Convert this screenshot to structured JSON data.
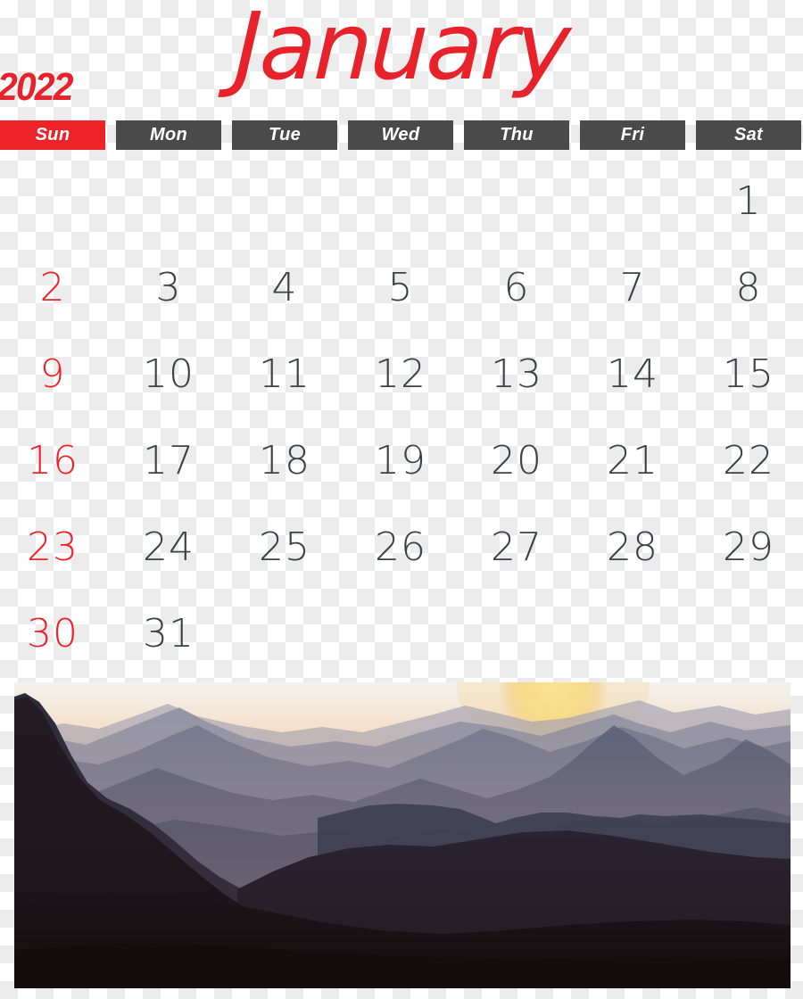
{
  "calendar": {
    "month": "January",
    "year": "2022",
    "accent_color": "#ee2229",
    "header_bar_color": "#4a4a4a",
    "date_text_color": "#3d4146",
    "weekdays": [
      {
        "short": "Sun",
        "highlight": true
      },
      {
        "short": "Mon",
        "highlight": false
      },
      {
        "short": "Tue",
        "highlight": false
      },
      {
        "short": "Wed",
        "highlight": false
      },
      {
        "short": "Thu",
        "highlight": false
      },
      {
        "short": "Fri",
        "highlight": false
      },
      {
        "short": "Sat",
        "highlight": false
      }
    ],
    "weeks": [
      [
        "",
        "",
        "",
        "",
        "",
        "",
        "1"
      ],
      [
        "2",
        "3",
        "4",
        "5",
        "6",
        "7",
        "8"
      ],
      [
        "9",
        "10",
        "11",
        "12",
        "13",
        "14",
        "15"
      ],
      [
        "16",
        "17",
        "18",
        "19",
        "20",
        "21",
        "22"
      ],
      [
        "23",
        "24",
        "25",
        "26",
        "27",
        "28",
        "29"
      ],
      [
        "30",
        "31",
        "",
        "",
        "",
        "",
        ""
      ]
    ]
  },
  "photo": {
    "subject": "mountain-sunset-landscape",
    "description": "Layered hazy mountain ridges silhouetted against an orange sunset sky with a setting sun",
    "sky_top_color": "#f2f1ef",
    "sky_mid_color": "#f7c39a",
    "sky_low_color": "#f0a175",
    "sun_color": "#f8de86",
    "foreground_color": "#1b1212"
  }
}
